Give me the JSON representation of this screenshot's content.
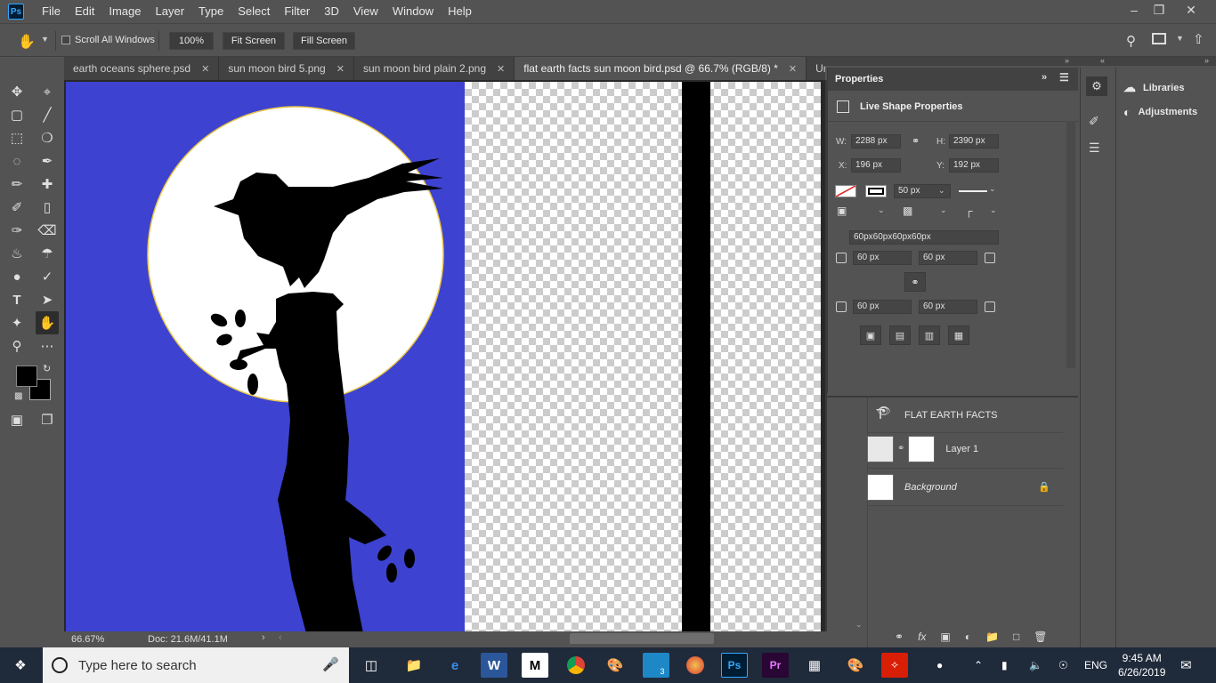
{
  "menubar": {
    "app_icon": "Ps",
    "items": [
      "File",
      "Edit",
      "Image",
      "Layer",
      "Type",
      "Select",
      "Filter",
      "3D",
      "View",
      "Window",
      "Help"
    ]
  },
  "options": {
    "scroll_all_windows": "Scroll All Windows",
    "zoom_100": "100%",
    "fit_screen": "Fit Screen",
    "fill_screen": "Fill Screen"
  },
  "tabs": [
    {
      "label": "earth oceans sphere.psd"
    },
    {
      "label": "sun moon bird 5.png"
    },
    {
      "label": "sun moon bird plain 2.png"
    },
    {
      "label": "flat earth facts sun moon bird.psd @ 66.7% (RGB/8) *"
    },
    {
      "label": "Untitled"
    }
  ],
  "status": {
    "zoom": "66.67%",
    "doc": "Doc: 21.6M/41.1M"
  },
  "properties": {
    "title": "Properties",
    "subtitle": "Live Shape Properties",
    "w_label": "W:",
    "w_value": "2288 px",
    "h_label": "H:",
    "h_value": "2390 px",
    "x_label": "X:",
    "x_value": "196 px",
    "y_label": "Y:",
    "y_value": "192 px",
    "stroke_width": "50 px",
    "corners_all": "60px60px60px60px",
    "corner_tl": "60 px",
    "corner_tr": "60 px",
    "corner_bl": "60 px",
    "corner_br": "60 px"
  },
  "layers": [
    {
      "name": "FLAT EARTH FACTS",
      "type": "text"
    },
    {
      "name": "Layer 1",
      "type": "layer"
    },
    {
      "name": "Background",
      "type": "background"
    }
  ],
  "dock": {
    "libraries": "Libraries",
    "adjustments": "Adjustments"
  },
  "taskbar": {
    "search_placeholder": "Type here to search",
    "lang": "ENG",
    "time": "9:45 AM",
    "date": "6/26/2019",
    "notification_count": "3"
  },
  "colors": {
    "canvas_blue": "#3d42d0",
    "ps_blue": "#31a8ff",
    "panel": "#535353"
  }
}
